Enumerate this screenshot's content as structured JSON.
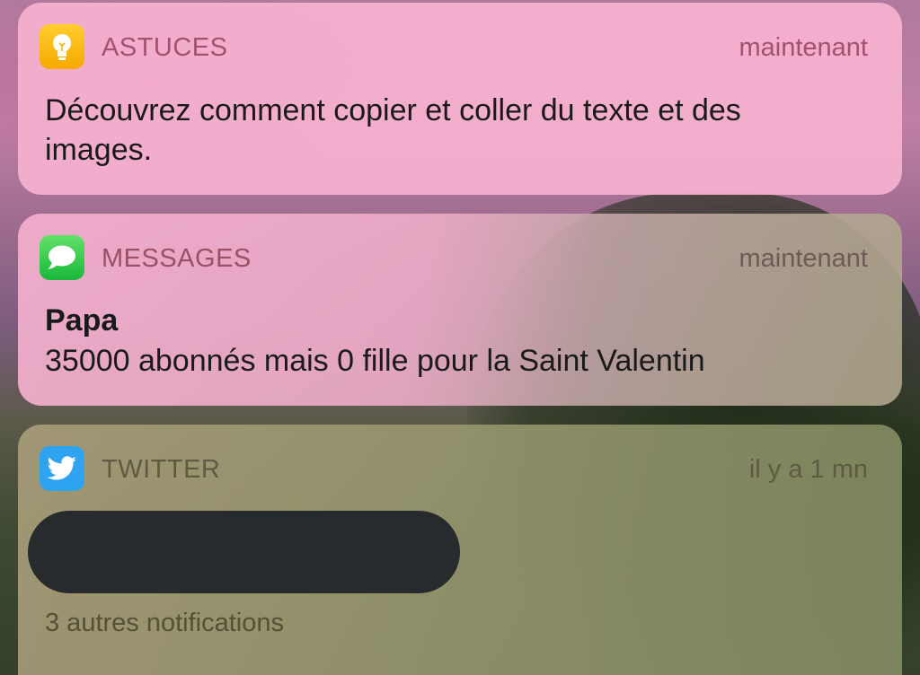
{
  "notifications": [
    {
      "app": "ASTUCES",
      "time": "maintenant",
      "icon": "lightbulb-icon",
      "body": "Découvrez comment copier et coller du texte et des images."
    },
    {
      "app": "MESSAGES",
      "time": "maintenant",
      "icon": "speech-bubble-icon",
      "sender": "Papa",
      "body": "35000 abonnés mais 0 fille pour la Saint Valentin"
    },
    {
      "app": "TWITTER",
      "time": "il y a 1 mn",
      "icon": "twitter-bird-icon",
      "more": "3 autres notifications"
    }
  ]
}
